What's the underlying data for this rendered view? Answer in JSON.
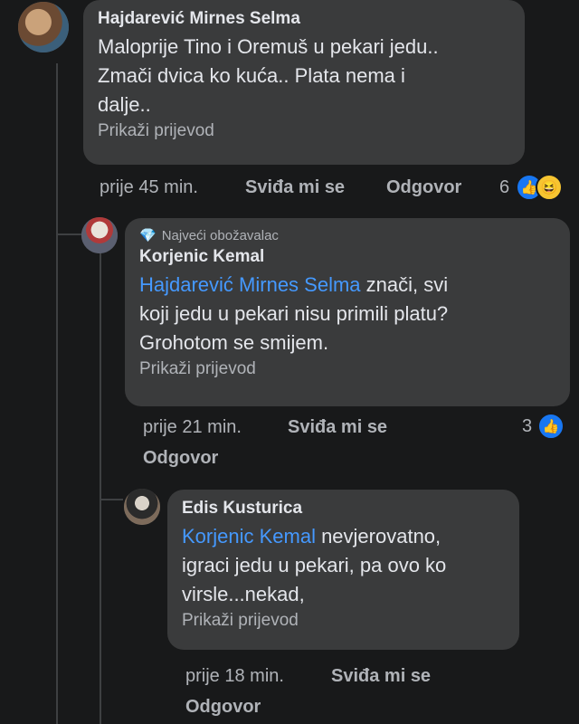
{
  "comments": [
    {
      "author": "Hajdarević Mirnes Selma",
      "text_lines": [
        "Maloprije Tino i Oremuš u pekari jedu..",
        "Zmači dvica ko kuća.. Plata nema i",
        "dalje.."
      ],
      "translate": "Prikaži prijevod",
      "time": "prije 45 min.",
      "like": "Sviđa mi se",
      "reply": "Odgovor",
      "reactions_count": "6",
      "reaction_icons": [
        "like-icon",
        "haha-icon"
      ]
    },
    {
      "badge": "Najveći obožavalac",
      "author": "Korjenic Kemal",
      "mention": "Hajdarević Mirnes Selma",
      "text_first_rest": " znači, svi",
      "text_lines": [
        "koji jedu u pekari nisu primili platu?",
        "Grohotom se smijem."
      ],
      "translate": "Prikaži prijevod",
      "time": "prije 21 min.",
      "like": "Sviđa mi se",
      "reply": "Odgovor",
      "reactions_count": "3",
      "reaction_icons": [
        "like-icon"
      ]
    },
    {
      "author": "Edis Kusturica",
      "mention": "Korjenic Kemal",
      "text_first_rest": " nevjerovatno,",
      "text_lines": [
        "igraci jedu u pekari, pa ovo ko",
        "virsle...nekad,"
      ],
      "translate": "Prikaži prijevod",
      "time": "prije 18 min.",
      "like": "Sviđa mi se",
      "reply": "Odgovor"
    }
  ],
  "colors": {
    "background": "#18191a",
    "bubble": "#3a3b3c",
    "mention": "#4599ff",
    "muted": "#b0b3b8",
    "like": "#1877f2"
  }
}
